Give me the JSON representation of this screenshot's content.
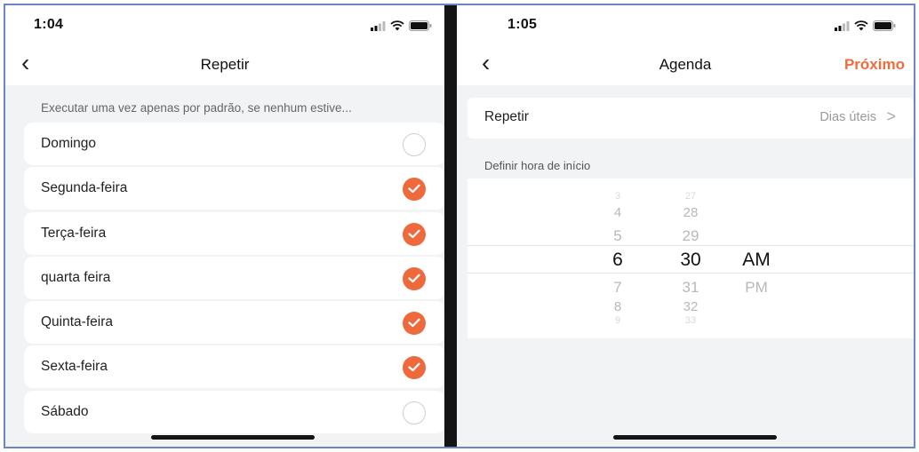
{
  "left": {
    "status_time": "1:04",
    "title": "Repetir",
    "back_glyph": "‹",
    "hint": "Executar uma vez apenas por padrão, se nenhum estive...",
    "days": [
      {
        "label": "Domingo",
        "checked": false
      },
      {
        "label": "Segunda-feira",
        "checked": true
      },
      {
        "label": "Terça-feira",
        "checked": true
      },
      {
        "label": "quarta feira",
        "checked": true
      },
      {
        "label": "Quinta-feira",
        "checked": true
      },
      {
        "label": "Sexta-feira",
        "checked": true
      },
      {
        "label": "Sábado",
        "checked": false
      }
    ]
  },
  "right": {
    "status_time": "1:05",
    "title": "Agenda",
    "next_label": "Próximo",
    "back_glyph": "‹",
    "repeat": {
      "label": "Repetir",
      "value": "Dias úteis",
      "chevron": ">"
    },
    "section_label": "Definir hora de início",
    "picker": {
      "hours": [
        "3",
        "4",
        "5",
        "6",
        "7",
        "8",
        "9"
      ],
      "minutes": [
        "27",
        "28",
        "29",
        "30",
        "31",
        "32",
        "33"
      ],
      "periods": [
        "AM",
        "PM"
      ],
      "selected_hour": "6",
      "selected_minute": "30",
      "selected_period": "AM"
    }
  },
  "colors": {
    "accent": "#ee6a3c",
    "next": "#f26b3a",
    "frame": "#6a86c4"
  },
  "icons": [
    "signal-icon",
    "wifi-icon",
    "battery-icon",
    "back-chevron-icon",
    "check-icon",
    "chevron-right-icon"
  ]
}
